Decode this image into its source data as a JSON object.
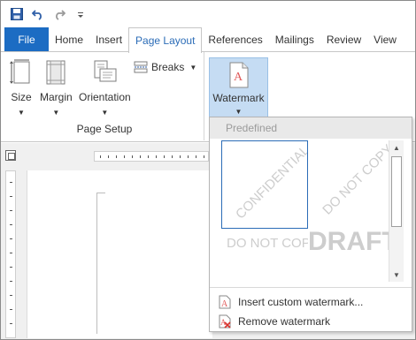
{
  "qat": {
    "save_icon": "save-icon",
    "undo_icon": "undo-icon",
    "redo_icon": "redo-icon",
    "customize_icon": "customize-qat-icon"
  },
  "tabs": [
    {
      "label": "File"
    },
    {
      "label": "Home"
    },
    {
      "label": "Insert"
    },
    {
      "label": "Page Layout"
    },
    {
      "label": "References"
    },
    {
      "label": "Mailings"
    },
    {
      "label": "Review"
    },
    {
      "label": "View"
    }
  ],
  "ribbon": {
    "page_setup": {
      "size_label": "Size",
      "margin_label": "Margin",
      "orientation_label": "Orientation",
      "breaks_label": "Breaks",
      "group_label": "Page Setup"
    },
    "watermark_label": "Watermark"
  },
  "watermark_menu": {
    "header": "Predefined",
    "thumbnails": [
      {
        "text": "CONFIDENTIAL",
        "selected": true
      },
      {
        "text": "DO NOT COPY",
        "selected": false
      },
      {
        "text": "DO NOT COPY",
        "selected": false
      },
      {
        "text": "DRAFT",
        "selected": false
      }
    ],
    "insert_custom_label": "Insert custom watermark...",
    "remove_label": "Remove watermark"
  },
  "colors": {
    "accent": "#1c6cc3",
    "active_tab_text": "#2b6cb7",
    "watermark_button_bg": "#c5dcf3"
  }
}
